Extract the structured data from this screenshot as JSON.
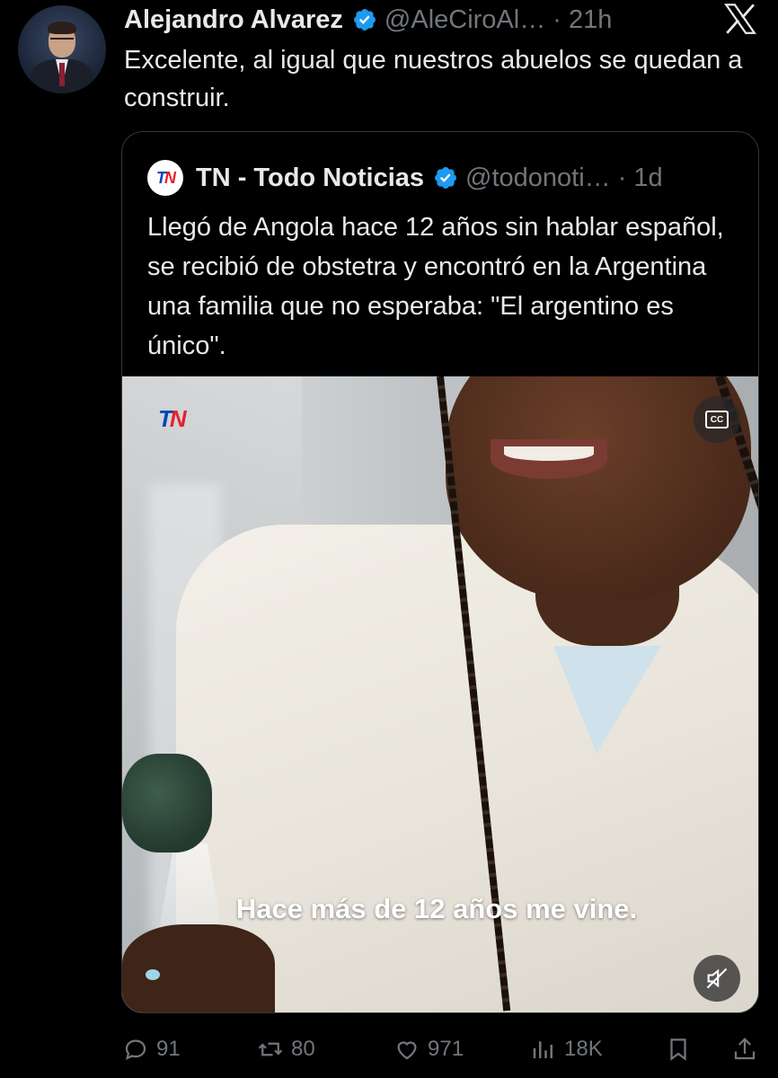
{
  "reply": {
    "author_name": "Alejandro Alvarez",
    "author_handle": "@AleCiroAl… · 21h",
    "text": "Excelente, al igual que nuestros abuelos se quedan a construir."
  },
  "quoted": {
    "author_name": "TN - Todo Noticias",
    "author_handle": "@todonoti… · 1d",
    "text": "Llegó de Angola hace 12 años sin hablar español, se recibió de obstetra y encontró en la Argentina una familia que no esperaba: \"El argentino es único\".",
    "video": {
      "subtitle": "Hace más de 12 años me vine.",
      "watermark": "TN"
    }
  },
  "actions": {
    "replies": "91",
    "reposts": "80",
    "likes": "971",
    "views": "18K"
  },
  "icons": [
    "verified-badge-icon",
    "x-logo-icon",
    "cc-icon",
    "muted-speaker-icon",
    "reply-icon",
    "repost-icon",
    "like-icon",
    "views-icon",
    "bookmark-icon",
    "share-icon"
  ],
  "colors": {
    "background": "#000000",
    "text": "#e7e9ea",
    "secondary": "#71767b",
    "verified": "#1d9bf0",
    "border": "#333639"
  }
}
